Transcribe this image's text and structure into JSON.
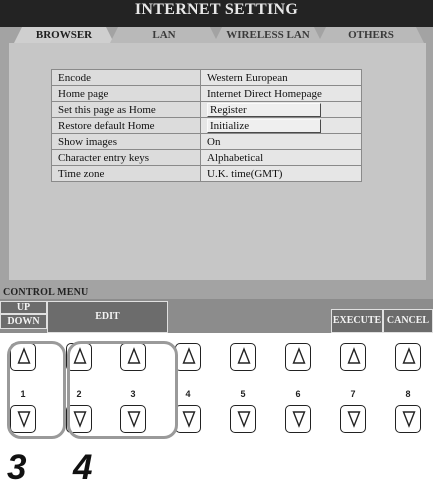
{
  "header": {
    "title": "INTERNET SETTING"
  },
  "tabs": [
    {
      "label": "BROWSER",
      "active": true
    },
    {
      "label": "LAN",
      "active": false
    },
    {
      "label": "WIRELESS LAN",
      "active": false
    },
    {
      "label": "OTHERS",
      "active": false
    }
  ],
  "settings": [
    {
      "label": "Encode",
      "value": "Western European"
    },
    {
      "label": "Home page",
      "value": "Internet Direct Homepage"
    },
    {
      "label": "Set this page as Home",
      "value": "Register"
    },
    {
      "label": "Restore default Home",
      "value": "Initialize"
    },
    {
      "label": "Show images",
      "value": "On"
    },
    {
      "label": "Character entry keys",
      "value": "Alphabetical"
    },
    {
      "label": "Time zone",
      "value": "U.K. time(GMT)"
    }
  ],
  "control_menu": {
    "label": "CONTROL MENU",
    "up": "UP",
    "down": "DOWN",
    "edit": "EDIT",
    "execute": "EXECUTE",
    "cancel": "CANCEL"
  },
  "buttons": {
    "up_symbol": "Δ",
    "down_symbol": "▽",
    "numbers": [
      "1",
      "2",
      "3",
      "4",
      "5",
      "6",
      "7",
      "8"
    ]
  },
  "callouts": [
    "3",
    "4"
  ],
  "colors": {
    "title_bar": "#232323",
    "screen_bg": "#a3a3a3",
    "panel_bg": "#c6c6c6",
    "control_button": "#6c6c6c",
    "group_outline": "#9a9a9a"
  }
}
